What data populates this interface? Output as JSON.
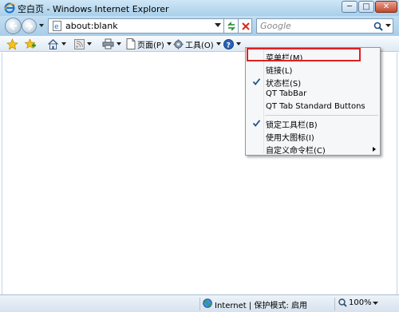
{
  "window": {
    "title": "空白页 - Windows Internet Explorer"
  },
  "title_controls": {
    "minimize": "─",
    "maximize": "□",
    "close": "✕"
  },
  "address_bar": {
    "url": "about:blank"
  },
  "search": {
    "placeholder": "Google"
  },
  "command_bar": {
    "page_label": "页面(P)",
    "tools_label": "工具(O)"
  },
  "context_menu": {
    "items": [
      {
        "label": "菜单栏(M)",
        "checked": false,
        "submenu": false
      },
      {
        "label": "链接(L)",
        "checked": false,
        "submenu": false
      },
      {
        "label": "状态栏(S)",
        "checked": true,
        "submenu": false
      },
      {
        "label": "QT TabBar",
        "checked": false,
        "submenu": false
      },
      {
        "label": "QT Tab Standard Buttons",
        "checked": false,
        "submenu": false
      },
      {
        "label": "锁定工具栏(B)",
        "checked": true,
        "submenu": false
      },
      {
        "label": "使用大图标(I)",
        "checked": false,
        "submenu": false
      },
      {
        "label": "自定义命令栏(C)",
        "checked": false,
        "submenu": true
      }
    ]
  },
  "status_bar": {
    "zone": "Internet | 保护模式: 启用",
    "zoom": "100%"
  },
  "colors": {
    "highlight_box": "#e02020",
    "title_bar": "#b9d8ee"
  }
}
